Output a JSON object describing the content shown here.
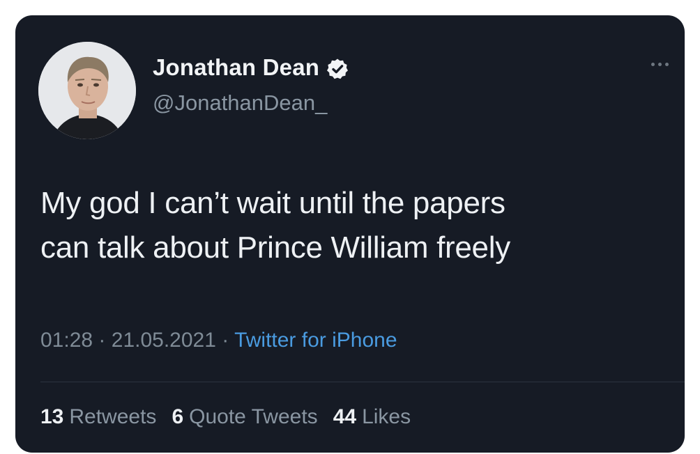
{
  "tweet": {
    "author": {
      "display_name": "Jonathan Dean",
      "handle": "@JonathanDean_",
      "verified": true,
      "verified_icon": "verified-badge-icon"
    },
    "more_icon": "more-options-icon",
    "text_line_1": "My god I can’t wait until the papers",
    "text_line_2": "can talk about Prince William freely",
    "time": "01:28",
    "separator": "·",
    "date": "21.05.2021",
    "source": "Twitter for iPhone",
    "stats": {
      "retweets_count": "13",
      "retweets_label": "Retweets",
      "quotes_count": "6",
      "quotes_label": "Quote Tweets",
      "likes_count": "44",
      "likes_label": "Likes"
    }
  },
  "colors": {
    "background": "#161b25",
    "text": "#eef1f4",
    "muted": "#8a96a2",
    "link": "#4a9be0"
  }
}
